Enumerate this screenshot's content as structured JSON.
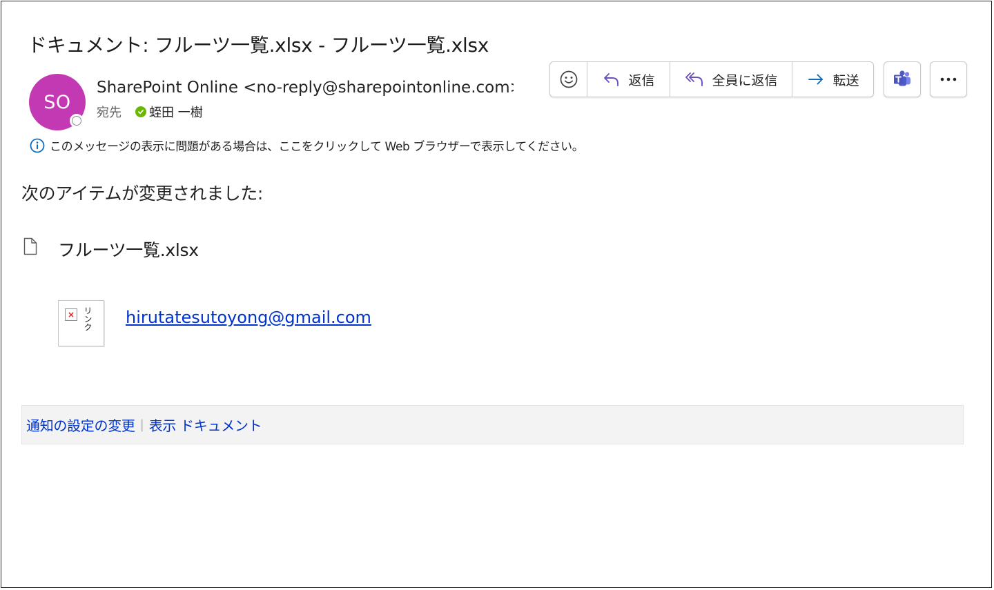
{
  "email": {
    "subject": "ドキュメント: フルーツ一覧.xlsx - フルーツ一覧.xlsx",
    "sender": {
      "initials": "SO",
      "display": "SharePoint Online <no-reply@sharepointonline.com>",
      "avatar_color": "#c239b3"
    },
    "to_label": "宛先",
    "recipient": "蛭田 一樹",
    "info_message": "このメッセージの表示に問題がある場合は、ここをクリックして Web ブラウザーで表示してください。"
  },
  "toolbar": {
    "reply_label": "返信",
    "reply_all_label": "全員に返信",
    "forward_label": "転送",
    "icons": [
      "emoji-icon",
      "reply-icon",
      "reply-all-icon",
      "forward-icon",
      "teams-icon",
      "more-icon"
    ]
  },
  "body": {
    "intro": "次のアイテムが変更されました:",
    "document_name": "フルーツ一覧.xlsx",
    "image_alt": "リンク",
    "link_email": "hirutatesutoyong@gmail.com"
  },
  "footer": {
    "notification_settings": "通知の設定の変更",
    "view_document": "表示 ドキュメント"
  },
  "colors": {
    "link": "#0033cc",
    "presence_available": "#6bb700",
    "teams": "#5059c9",
    "forward_arrow": "#0f6cbd"
  }
}
